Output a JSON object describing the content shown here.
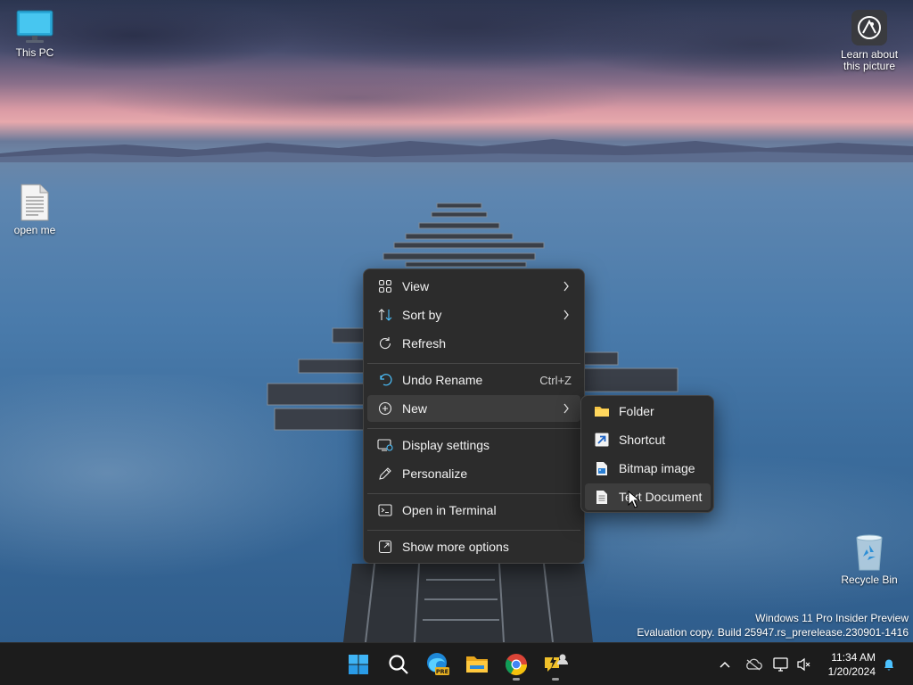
{
  "desktop": {
    "icons": [
      {
        "label": "This PC",
        "icon": "monitor-icon"
      },
      {
        "label": "open me",
        "icon": "text-file-icon"
      },
      {
        "label": "Learn about this picture",
        "icon": "camera-info-icon"
      },
      {
        "label": "Recycle Bin",
        "icon": "recycle-bin-icon"
      }
    ],
    "watermark": {
      "line1": "Windows 11 Pro Insider Preview",
      "line2": "Evaluation copy. Build 25947.rs_prerelease.230901-1416"
    }
  },
  "context_menu": {
    "items": [
      {
        "label": "View",
        "icon": "grid-icon",
        "has_submenu": true
      },
      {
        "label": "Sort by",
        "icon": "sort-icon",
        "has_submenu": true
      },
      {
        "label": "Refresh",
        "icon": "refresh-icon"
      },
      {
        "label": "Undo Rename",
        "icon": "undo-icon",
        "shortcut": "Ctrl+Z"
      },
      {
        "label": "New",
        "icon": "plus-circle-icon",
        "has_submenu": true,
        "highlighted": true
      },
      {
        "label": "Display settings",
        "icon": "display-settings-icon"
      },
      {
        "label": "Personalize",
        "icon": "pen-icon"
      },
      {
        "label": "Open in Terminal",
        "icon": "terminal-icon"
      },
      {
        "label": "Show more options",
        "icon": "external-icon"
      }
    ]
  },
  "new_submenu": {
    "items": [
      {
        "label": "Folder",
        "icon": "folder-icon"
      },
      {
        "label": "Shortcut",
        "icon": "shortcut-icon"
      },
      {
        "label": "Bitmap image",
        "icon": "bitmap-icon"
      },
      {
        "label": "Text Document",
        "icon": "text-document-icon",
        "highlighted": true
      }
    ]
  },
  "taskbar": {
    "apps": [
      "start-icon",
      "search-icon",
      "edge-beta-icon",
      "file-explorer-icon",
      "chrome-icon",
      "feedback-hub-icon"
    ],
    "edge_badge": "PRE",
    "tray": [
      "chevron-up-icon",
      "onedrive-icon",
      "network-icon",
      "volume-muted-icon"
    ],
    "time": "11:34 AM",
    "date": "1/20/2024"
  },
  "colors": {
    "accent": "#4cc2ff",
    "menu_bg": "#2c2c2c",
    "taskbar_bg": "#1c1c1c"
  }
}
